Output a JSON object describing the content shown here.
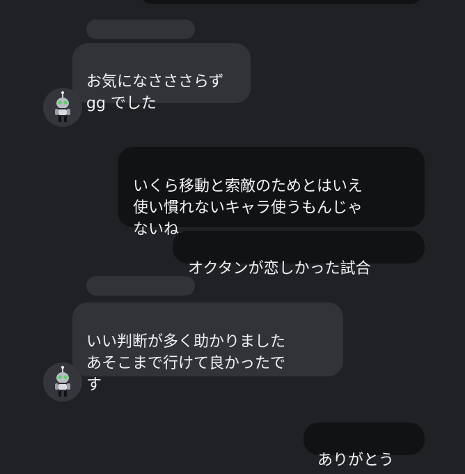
{
  "messages": [
    {
      "type": "outgoing",
      "text": ""
    },
    {
      "type": "incoming",
      "text": "お気になさささらず\ngg でした"
    },
    {
      "type": "outgoing",
      "text": "いくら移動と索敵のためとはいえ\n使い慣れないキャラ使うもんじゃ\nないね…"
    },
    {
      "type": "outgoing",
      "text": "オクタンが恋しかった試合"
    },
    {
      "type": "incoming",
      "text": "いい判断が多く助かりました\nあそこまで行けて良かったで\nす"
    },
    {
      "type": "outgoing",
      "text": "ありがとう"
    }
  ],
  "avatar": {
    "icon": "robot-avatar-icon"
  }
}
